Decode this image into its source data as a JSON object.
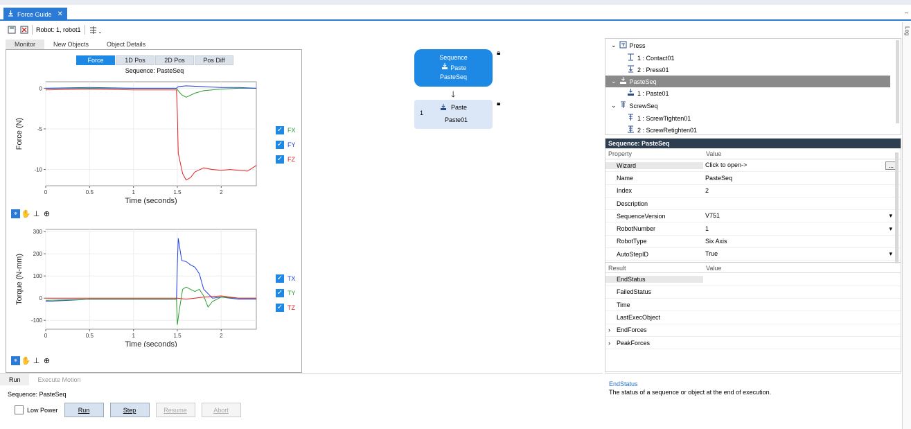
{
  "tab": {
    "title": "Force Guide",
    "close": "✕"
  },
  "side_panel_label": "Log",
  "toolbar": {
    "robot_label": "Robot: 1, robot1"
  },
  "subtabs": [
    "Monitor",
    "New Objects",
    "Object Details"
  ],
  "monitor": {
    "modes": [
      "Force",
      "1D Pos",
      "2D Pos",
      "Pos Diff"
    ],
    "active_mode": "Force",
    "sequence_title": "Sequence: PasteSeq"
  },
  "chart_data": [
    {
      "type": "line",
      "title": "",
      "xlabel": "Time (seconds)",
      "ylabel": "Force (N)",
      "xlim": [
        0,
        2.4
      ],
      "ylim": [
        -12,
        0.8
      ],
      "x_ticks": [
        "0",
        "0.5",
        "1",
        "1.5",
        "2"
      ],
      "y_ticks": [
        "0",
        "-5",
        "-10"
      ],
      "grid": true,
      "series": [
        {
          "name": "FX",
          "color": "#2e9e2e",
          "x": [
            0,
            0.5,
            1.0,
            1.49,
            1.51,
            1.55,
            1.6,
            1.7,
            1.8,
            2.0,
            2.2,
            2.4
          ],
          "values": [
            0,
            0,
            0,
            0,
            -0.3,
            -0.8,
            -1.1,
            -0.6,
            -0.3,
            -0.1,
            0,
            0
          ]
        },
        {
          "name": "FY",
          "color": "#2040e0",
          "x": [
            0,
            0.5,
            1.0,
            1.49,
            1.51,
            1.6,
            1.8,
            2.0,
            2.2,
            2.4
          ],
          "values": [
            0,
            0.1,
            0,
            0,
            0.2,
            0.3,
            0.2,
            0.1,
            0.1,
            0
          ]
        },
        {
          "name": "FZ",
          "color": "#e02020",
          "x": [
            0,
            0.5,
            1.0,
            1.49,
            1.5,
            1.51,
            1.53,
            1.56,
            1.6,
            1.65,
            1.7,
            1.8,
            1.9,
            2.0,
            2.1,
            2.2,
            2.3,
            2.4
          ],
          "values": [
            -0.2,
            -0.1,
            -0.2,
            -0.2,
            -3,
            -8,
            -9,
            -10.5,
            -11.3,
            -11,
            -10.3,
            -9.8,
            -10,
            -10.1,
            -10,
            -10.1,
            -10.2,
            -9.5
          ]
        }
      ]
    },
    {
      "type": "line",
      "title": "",
      "xlabel": "Time (seconds)",
      "ylabel": "Torque (N-mm)",
      "xlim": [
        0,
        2.4
      ],
      "ylim": [
        -140,
        310
      ],
      "x_ticks": [
        "0",
        "0.5",
        "1",
        "1.5",
        "2"
      ],
      "y_ticks": [
        "300",
        "200",
        "100",
        "0",
        "-100"
      ],
      "grid": true,
      "series": [
        {
          "name": "TX",
          "color": "#2040e0",
          "x": [
            0,
            0.5,
            1.0,
            1.49,
            1.5,
            1.51,
            1.55,
            1.6,
            1.65,
            1.7,
            1.75,
            1.8,
            1.9,
            2.0,
            2.2,
            2.4
          ],
          "values": [
            -15,
            -5,
            -5,
            -5,
            150,
            270,
            170,
            165,
            150,
            140,
            110,
            40,
            0,
            5,
            -5,
            -5
          ]
        },
        {
          "name": "TY",
          "color": "#2e9e2e",
          "x": [
            0,
            0.5,
            1.0,
            1.49,
            1.5,
            1.52,
            1.56,
            1.6,
            1.65,
            1.7,
            1.75,
            1.8,
            1.85,
            1.9,
            2.0,
            2.2,
            2.4
          ],
          "values": [
            -10,
            -5,
            -5,
            -5,
            -120,
            -60,
            40,
            50,
            40,
            30,
            40,
            10,
            -40,
            -15,
            5,
            0,
            0
          ]
        },
        {
          "name": "TZ",
          "color": "#e02020",
          "x": [
            0,
            0.5,
            1.0,
            1.5,
            1.6,
            1.8,
            2.0,
            2.2,
            2.4
          ],
          "values": [
            0,
            0,
            0,
            0,
            -5,
            5,
            10,
            0,
            0
          ]
        }
      ]
    }
  ],
  "flow": {
    "sequence_node": {
      "line1": "Sequence",
      "line2": "Paste",
      "line3": "PasteSeq"
    },
    "object_node": {
      "index": "1",
      "label": "Paste",
      "name": "Paste01"
    }
  },
  "tree": [
    {
      "label": "Press",
      "level": 0,
      "expanded": true
    },
    {
      "label": "1 : Contact01",
      "level": 1
    },
    {
      "label": "2 : Press01",
      "level": 1
    },
    {
      "label": "PasteSeq",
      "level": 0,
      "expanded": true,
      "selected": true
    },
    {
      "label": "1 : Paste01",
      "level": 1
    },
    {
      "label": "ScrewSeq",
      "level": 0,
      "expanded": true
    },
    {
      "label": "1 : ScrewTighten01",
      "level": 1
    },
    {
      "label": "2 : ScrewRetighten01",
      "level": 1
    }
  ],
  "properties": {
    "header": "Sequence: PasteSeq",
    "col_property": "Property",
    "col_value": "Value",
    "rows": [
      {
        "key": "Wizard",
        "value": "Click to open->",
        "button": "..."
      },
      {
        "key": "Name",
        "value": "PasteSeq"
      },
      {
        "key": "Index",
        "value": "2"
      },
      {
        "key": "Description",
        "value": ""
      },
      {
        "key": "SequenceVersion",
        "value": "V751",
        "dropdown": true
      },
      {
        "key": "RobotNumber",
        "value": "1",
        "dropdown": true
      },
      {
        "key": "RobotType",
        "value": "Six Axis"
      },
      {
        "key": "AutoStepID",
        "value": "True",
        "dropdown": true
      }
    ],
    "result_col": "Result",
    "result_value_col": "Value",
    "results": [
      {
        "key": "EndStatus",
        "value": ""
      },
      {
        "key": "FailedStatus",
        "value": ""
      },
      {
        "key": "Time",
        "value": ""
      },
      {
        "key": "LastExecObject",
        "value": ""
      },
      {
        "key": "EndForces",
        "value": "",
        "expandable": true
      },
      {
        "key": "PeakForces",
        "value": "",
        "expandable": true
      }
    ]
  },
  "run_panel": {
    "tabs": [
      "Run",
      "Execute Motion"
    ],
    "sequence": "Sequence: PasteSeq",
    "low_power": "Low Power",
    "buttons": [
      "Run",
      "Step",
      "Resume",
      "Abort"
    ]
  },
  "description": {
    "title": "EndStatus",
    "text": "The status of a sequence or object at the end of execution."
  }
}
